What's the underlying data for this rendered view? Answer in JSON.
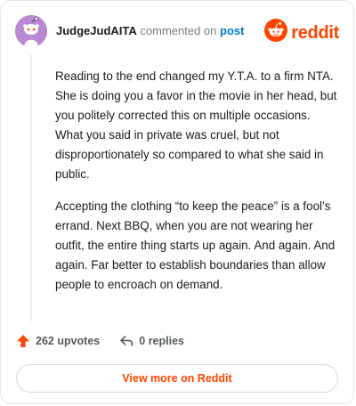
{
  "comment": {
    "author": "JudgeJudAITA",
    "action_text": "commented on",
    "post_link": "post",
    "paragraphs": [
      "Reading to the end changed my Y.T.A. to a firm NTA. She is doing you a favor in the movie in her head, but you politely corrected this on multiple occasions. What you said in private was cruel, but not disproportionately so compared to what she said in public.",
      "Accepting the clothing “to keep the peace” is a fool’s errand. Next BBQ, when you are not wearing her outfit, the entire thing starts up again. And again. And again. Far better to establish boundaries than allow people to encroach on demand."
    ]
  },
  "brand": {
    "name": "reddit",
    "icon": "reddit-logo-icon"
  },
  "avatar": {
    "icon": "snoo-avatar-icon",
    "color": "#b98ad4"
  },
  "actions": {
    "upvotes": "262 upvotes",
    "upvote_icon": "upvote-arrow-icon",
    "replies": "0 replies",
    "reply_icon": "reply-arrow-icon"
  },
  "view_more": "View more on Reddit",
  "colors": {
    "accent": "#ff4500",
    "link": "#0079d3",
    "text": "#1c1c1c",
    "muted": "#7c7c7c"
  }
}
